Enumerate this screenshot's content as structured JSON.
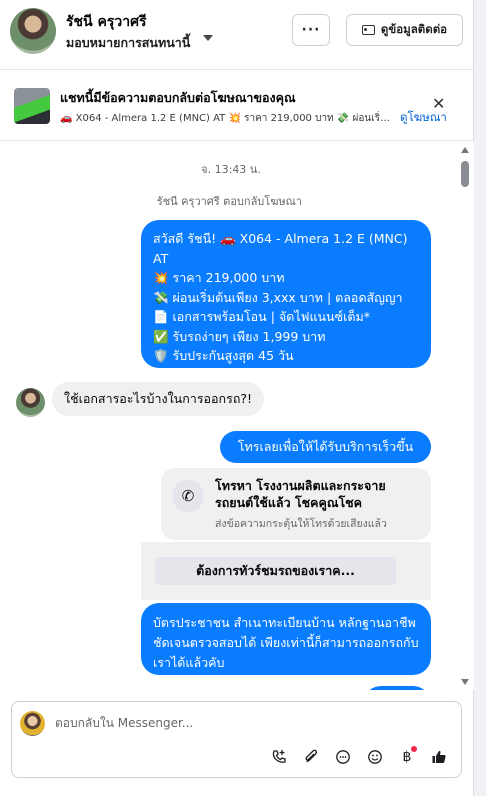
{
  "header": {
    "contact_name": "รัชนี ครุวาศรี",
    "assignment_label": "มอบหมายการสนทนานี้",
    "more_button": "···",
    "view_contact_button": "ดูข้อมูลติดต่อ"
  },
  "ad_banner": {
    "title": "แชทนี้มีข้อความตอบกลับต่อโฆษณาของคุณ",
    "summary": "🚗 X064 - Almera 1.2 E (MNC) AT 💥 ราคา 219,000 บาท 💸 ผ่อนเริ่มต์...",
    "view_ad_link": "ดูโฆษณา"
  },
  "chat": {
    "timestamp": "จ. 13:43 น.",
    "reply_note": "รัชนี ครุวาศรี ตอบกลับโฆษณา",
    "ad_message_lines": [
      "สวัสดี รัชนี! 🚗 X064 - Almera 1.2 E (MNC)",
      "AT",
      "💥 ราคา 219,000 บาท",
      "💸 ผ่อนเริ่มต้นเพียง 3,xxx บาท | ตลอดสัญญา",
      "📄 เอกสารพร้อมโอน | จัดไฟแนนซ์เต็ม*",
      "✅ รับรถง่ายๆ เพียง 1,999 บาท",
      "🛡️ รับประกันสูงสุด 45 วัน"
    ],
    "incoming_message": "ใช้เอกสารอะไรบ้างในการออกรถ?!",
    "outgoing_call_prompt": "โทรเลยเพื่อให้ได้รับบริการเร็วขึ้น",
    "call_card": {
      "title": "โทรหา โรงงานผลิตและกระจายรถยนต์ใช้แล้ว โชคคูณโชค",
      "subtitle": "ส่งข้อความกระตุ้นให้โทรด้วยเสียงแล้ว"
    },
    "tour_button": "ต้องการทัวร์ชมรถของเราค...",
    "documents_message": "บัตรประชาชน สำเนาทะเบียนบ้าน หลักฐานอาชีพชัดเจนตรวจสอบได้ เพียงเท่านี้ก็สามารถออกรถกับเราได้แล้วคับ"
  },
  "composer": {
    "placeholder": "ตอบกลับใน Messenger..."
  },
  "icons": {
    "call_add": "phone-plus-icon",
    "attach": "paperclip-icon",
    "saved_replies": "chat-bubble-icon",
    "emoji": "smiley-icon",
    "payment": "baht-icon",
    "like": "thumbs-up-icon"
  },
  "colors": {
    "outgoing_bubble": "#0a7cff",
    "incoming_bubble": "#f0f0f0",
    "link": "#0064d1",
    "notification_dot": "#f02849"
  }
}
